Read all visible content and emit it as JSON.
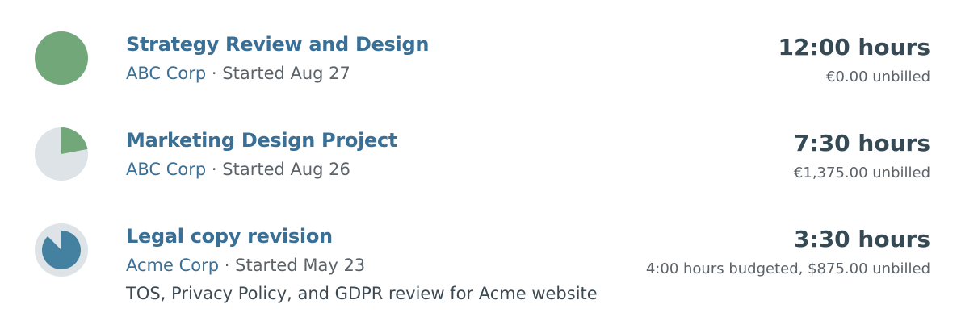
{
  "colors": {
    "progress_green": "#72a77a",
    "progress_blue": "#44809f",
    "track_gray": "#dde3e7",
    "title_blue": "#3a6f96"
  },
  "projects": [
    {
      "title": "Strategy Review and Design",
      "client": "ABC Corp",
      "started": "Started Aug 27",
      "hours": "12:00 hours",
      "billing": "€0.00 unbilled",
      "progress": 1.0
    },
    {
      "title": "Marketing Design Project",
      "client": "ABC Corp",
      "started": "Started Aug 26",
      "hours": "7:30 hours",
      "billing": "€1,375.00 unbilled",
      "progress": 0.22
    },
    {
      "title": "Legal copy revision",
      "client": "Acme Corp",
      "started": "Started May 23",
      "description": "TOS, Privacy Policy, and GDPR review for Acme website",
      "hours": "3:30 hours",
      "billing": "4:00 hours budgeted, $875.00 unbilled",
      "progress": 0.875
    }
  ]
}
